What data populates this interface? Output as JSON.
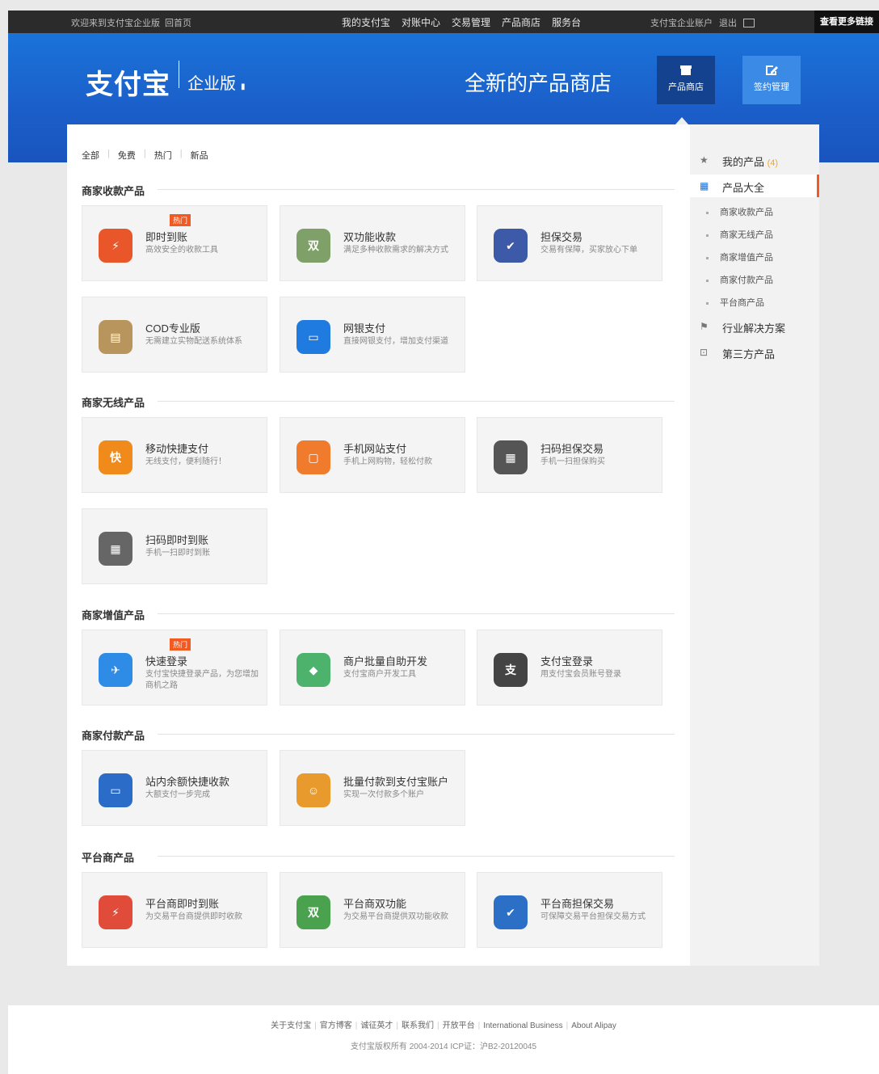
{
  "topbar": {
    "welcome": "欢迎来到支付宝企业版",
    "back_home": "回首页",
    "nav": [
      "我的支付宝",
      "对账中心",
      "交易管理",
      "产品商店",
      "服务台"
    ],
    "account": "支付宝企业账户",
    "logout": "退出",
    "dark_label": "查看更多链接"
  },
  "banner": {
    "logo": "支付宝",
    "edition": "企业版",
    "title": "全新的产品商店",
    "store_btn": "产品商店",
    "sign_btn": "签约管理"
  },
  "filters": [
    "全部",
    "免费",
    "热门",
    "新品"
  ],
  "sections": [
    {
      "title": "商家收款产品",
      "cards": [
        {
          "name": "即时到账",
          "desc": "高效安全的收款工具",
          "hot": "热门",
          "icon": "lightning-icon",
          "color": "#e8562a",
          "glyph": "⚡"
        },
        {
          "name": "双功能收款",
          "desc": "满足多种收款需求的解决方式",
          "icon": "double-icon",
          "color": "#7fa068",
          "glyph": "双"
        },
        {
          "name": "担保交易",
          "desc": "交易有保障，买家放心下单",
          "icon": "shield-icon",
          "color": "#3d5aa8",
          "glyph": "✔"
        },
        {
          "name": "COD专业版",
          "desc": "无需建立实物配送系统体系",
          "icon": "box-icon",
          "color": "#b8955c",
          "glyph": "▤"
        },
        {
          "name": "网银支付",
          "desc": "直接网银支付，增加支付渠道",
          "icon": "monitor-icon",
          "color": "#1f7be0",
          "glyph": "▭"
        }
      ]
    },
    {
      "title": "商家无线产品",
      "cards": [
        {
          "name": "移动快捷支付",
          "desc": "无线支付，便利随行！",
          "icon": "quickpay-icon",
          "color": "#f08a1a",
          "glyph": "快"
        },
        {
          "name": "手机网站支付",
          "desc": "手机上网购物，轻松付款",
          "icon": "tablet-icon",
          "color": "#f07b2c",
          "glyph": "▢"
        },
        {
          "name": "扫码担保交易",
          "desc": "手机一扫担保购买",
          "icon": "qr-icon",
          "color": "#555",
          "glyph": "▦"
        },
        {
          "name": "扫码即时到账",
          "desc": "手机一扫即时到账",
          "icon": "qr-instant-icon",
          "color": "#666",
          "glyph": "▦"
        }
      ]
    },
    {
      "title": "商家增值产品",
      "cards": [
        {
          "name": "快速登录",
          "desc": "支付宝快捷登录产品，为您增加商机之路",
          "hot": "热门",
          "icon": "compass-icon",
          "color": "#2f8ce6",
          "glyph": "✈"
        },
        {
          "name": "商户批量自助开发",
          "desc": "支付宝商户开发工具",
          "icon": "cube-icon",
          "color": "#4db36c",
          "glyph": "◆"
        },
        {
          "name": "支付宝登录",
          "desc": "用支付宝会员账号登录",
          "icon": "alipay-icon",
          "color": "#444",
          "glyph": "支"
        }
      ]
    },
    {
      "title": "商家付款产品",
      "cards": [
        {
          "name": "站内余额快捷收款",
          "desc": "大额支付一步完成",
          "icon": "card-icon",
          "color": "#2a6cc7",
          "glyph": "▭"
        },
        {
          "name": "批量付款到支付宝账户",
          "desc": "实现一次付款多个账户",
          "icon": "users-icon",
          "color": "#e89a2c",
          "glyph": "☺"
        }
      ]
    },
    {
      "title": "平台商产品",
      "cards": [
        {
          "name": "平台商即时到账",
          "desc": "为交易平台商提供即时收款",
          "icon": "store-red-icon",
          "color": "#e04b3a",
          "glyph": "⚡"
        },
        {
          "name": "平台商双功能",
          "desc": "为交易平台商提供双功能收款",
          "icon": "store-green-icon",
          "color": "#4aa24e",
          "glyph": "双"
        },
        {
          "name": "平台商担保交易",
          "desc": "可保障交易平台担保交易方式",
          "icon": "store-blue-icon",
          "color": "#2c6fc7",
          "glyph": "✔"
        }
      ]
    }
  ],
  "sidebar": {
    "my_products": "我的产品",
    "my_products_count": "(4)",
    "all_products": "产品大全",
    "subs": [
      "商家收款产品",
      "商家无线产品",
      "商家增值产品",
      "商家付款产品",
      "平台商产品"
    ],
    "industry": "行业解决方案",
    "third_party": "第三方产品"
  },
  "footer": {
    "links": [
      "关于支付宝",
      "官方博客",
      "诚征英才",
      "联系我们",
      "开放平台",
      "International Business",
      "About Alipay"
    ],
    "copyright": "支付宝版权所有 2004-2014 ICP证：沪B2-20120045"
  }
}
